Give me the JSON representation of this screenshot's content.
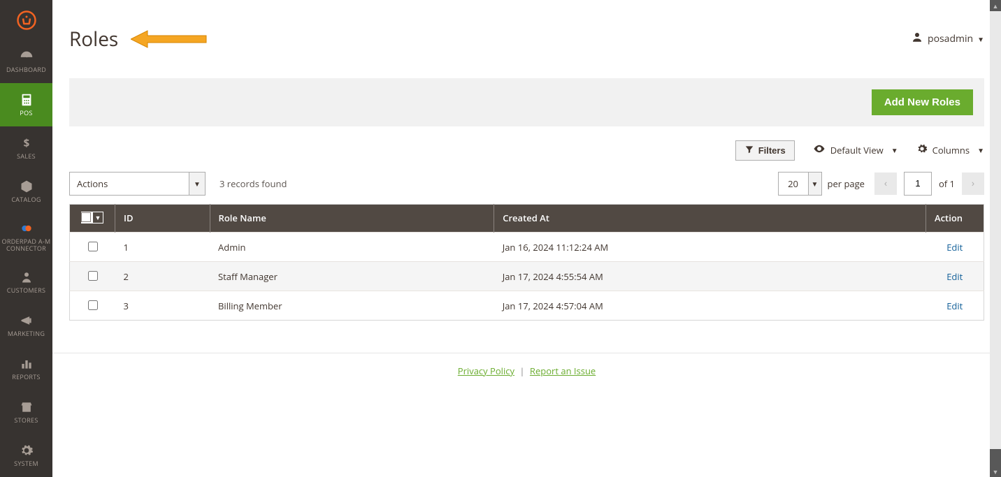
{
  "sidebar": {
    "items": [
      {
        "label": "DASHBOARD",
        "icon": "dashboard"
      },
      {
        "label": "POS",
        "icon": "pos",
        "active": true
      },
      {
        "label": "SALES",
        "icon": "sales"
      },
      {
        "label": "CATALOG",
        "icon": "catalog"
      },
      {
        "label": "ORDERPAD A-M CONNECTOR",
        "icon": "connector"
      },
      {
        "label": "CUSTOMERS",
        "icon": "customers"
      },
      {
        "label": "MARKETING",
        "icon": "marketing"
      },
      {
        "label": "REPORTS",
        "icon": "reports"
      },
      {
        "label": "STORES",
        "icon": "stores"
      },
      {
        "label": "SYSTEM",
        "icon": "system"
      }
    ]
  },
  "page": {
    "title": "Roles"
  },
  "user": {
    "name": "posadmin"
  },
  "buttons": {
    "add_new": "Add New Roles"
  },
  "toolbar": {
    "filters": "Filters",
    "default_view": "Default View",
    "columns": "Columns"
  },
  "actions": {
    "label": "Actions"
  },
  "records": {
    "found_text": "3 records found"
  },
  "pagination": {
    "per_page_value": "20",
    "per_page_label": "per page",
    "current_page": "1",
    "total_text": "of 1"
  },
  "table": {
    "headers": {
      "id": "ID",
      "role_name": "Role Name",
      "created_at": "Created At",
      "action": "Action"
    },
    "rows": [
      {
        "id": "1",
        "role_name": "Admin",
        "created_at": "Jan 16, 2024 11:12:24 AM",
        "action": "Edit"
      },
      {
        "id": "2",
        "role_name": "Staff Manager",
        "created_at": "Jan 17, 2024 4:55:54 AM",
        "action": "Edit"
      },
      {
        "id": "3",
        "role_name": "Billing Member",
        "created_at": "Jan 17, 2024 4:57:04 AM",
        "action": "Edit"
      }
    ]
  },
  "footer": {
    "privacy": "Privacy Policy",
    "report": "Report an Issue"
  }
}
